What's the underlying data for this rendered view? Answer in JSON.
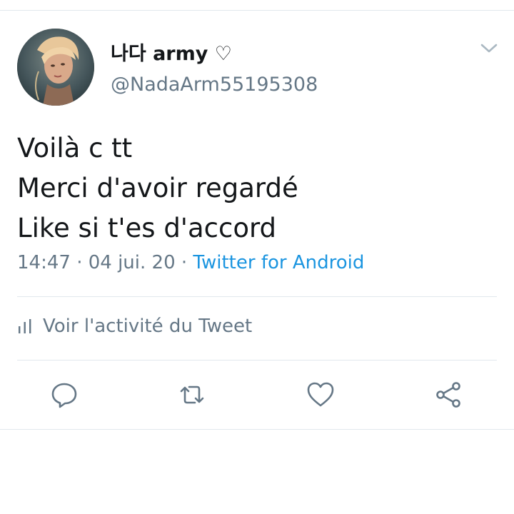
{
  "tweet": {
    "display_name": "나다 army ♡",
    "handle": "@NadaArm55195308",
    "text_lines": [
      "Voilà c tt",
      "Merci d'avoir regardé",
      "Like si t'es d'accord"
    ],
    "time": "14:47",
    "date": "04 jui. 20",
    "separator": "·",
    "source": "Twitter for Android"
  },
  "activity": {
    "label": "Voir l'activité du Tweet",
    "icon": "stats-icon"
  },
  "actions": [
    {
      "name": "reply",
      "icon": "reply-icon"
    },
    {
      "name": "retweet",
      "icon": "retweet-icon"
    },
    {
      "name": "like",
      "icon": "heart-icon"
    },
    {
      "name": "share",
      "icon": "share-icon"
    }
  ],
  "colors": {
    "text": "#14171a",
    "secondary": "#657786",
    "link": "#1b95e0",
    "divider": "#e1e8ed"
  }
}
